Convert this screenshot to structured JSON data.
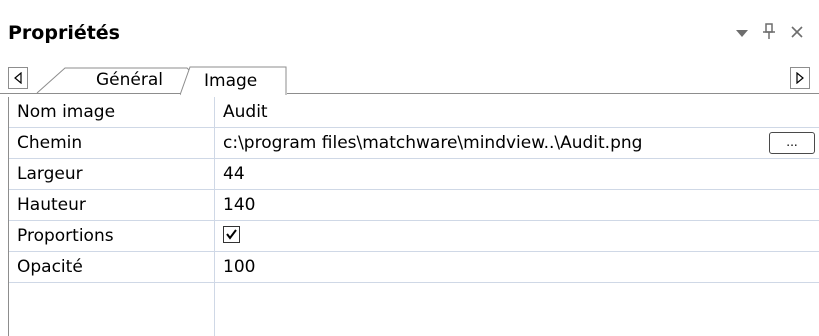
{
  "panel": {
    "title": "Propriétés",
    "controls": {
      "dropdown_icon": "triangle-down-icon",
      "pin_icon": "pin-icon",
      "close_icon": "close-icon"
    }
  },
  "tabs": {
    "scroll_left_icon": "triangle-left-icon",
    "scroll_right_icon": "triangle-right-icon",
    "items": [
      {
        "label": "Général",
        "active": false
      },
      {
        "label": "Image",
        "active": true
      }
    ]
  },
  "properties": [
    {
      "name": "Nom image",
      "value": "Audit"
    },
    {
      "name": "Chemin",
      "value": "c:\\program files\\matchware\\mindview..\\Audit.png",
      "button_label": "..."
    },
    {
      "name": "Largeur",
      "value": "44"
    },
    {
      "name": "Hauteur",
      "value": "140"
    },
    {
      "name": "Proportions",
      "checked": true
    },
    {
      "name": "Opacité",
      "value": "100"
    }
  ],
  "colors": {
    "grid_line": "#cfd8e6",
    "border": "#8d8d8d",
    "control_icon": "#7a7a7a"
  }
}
